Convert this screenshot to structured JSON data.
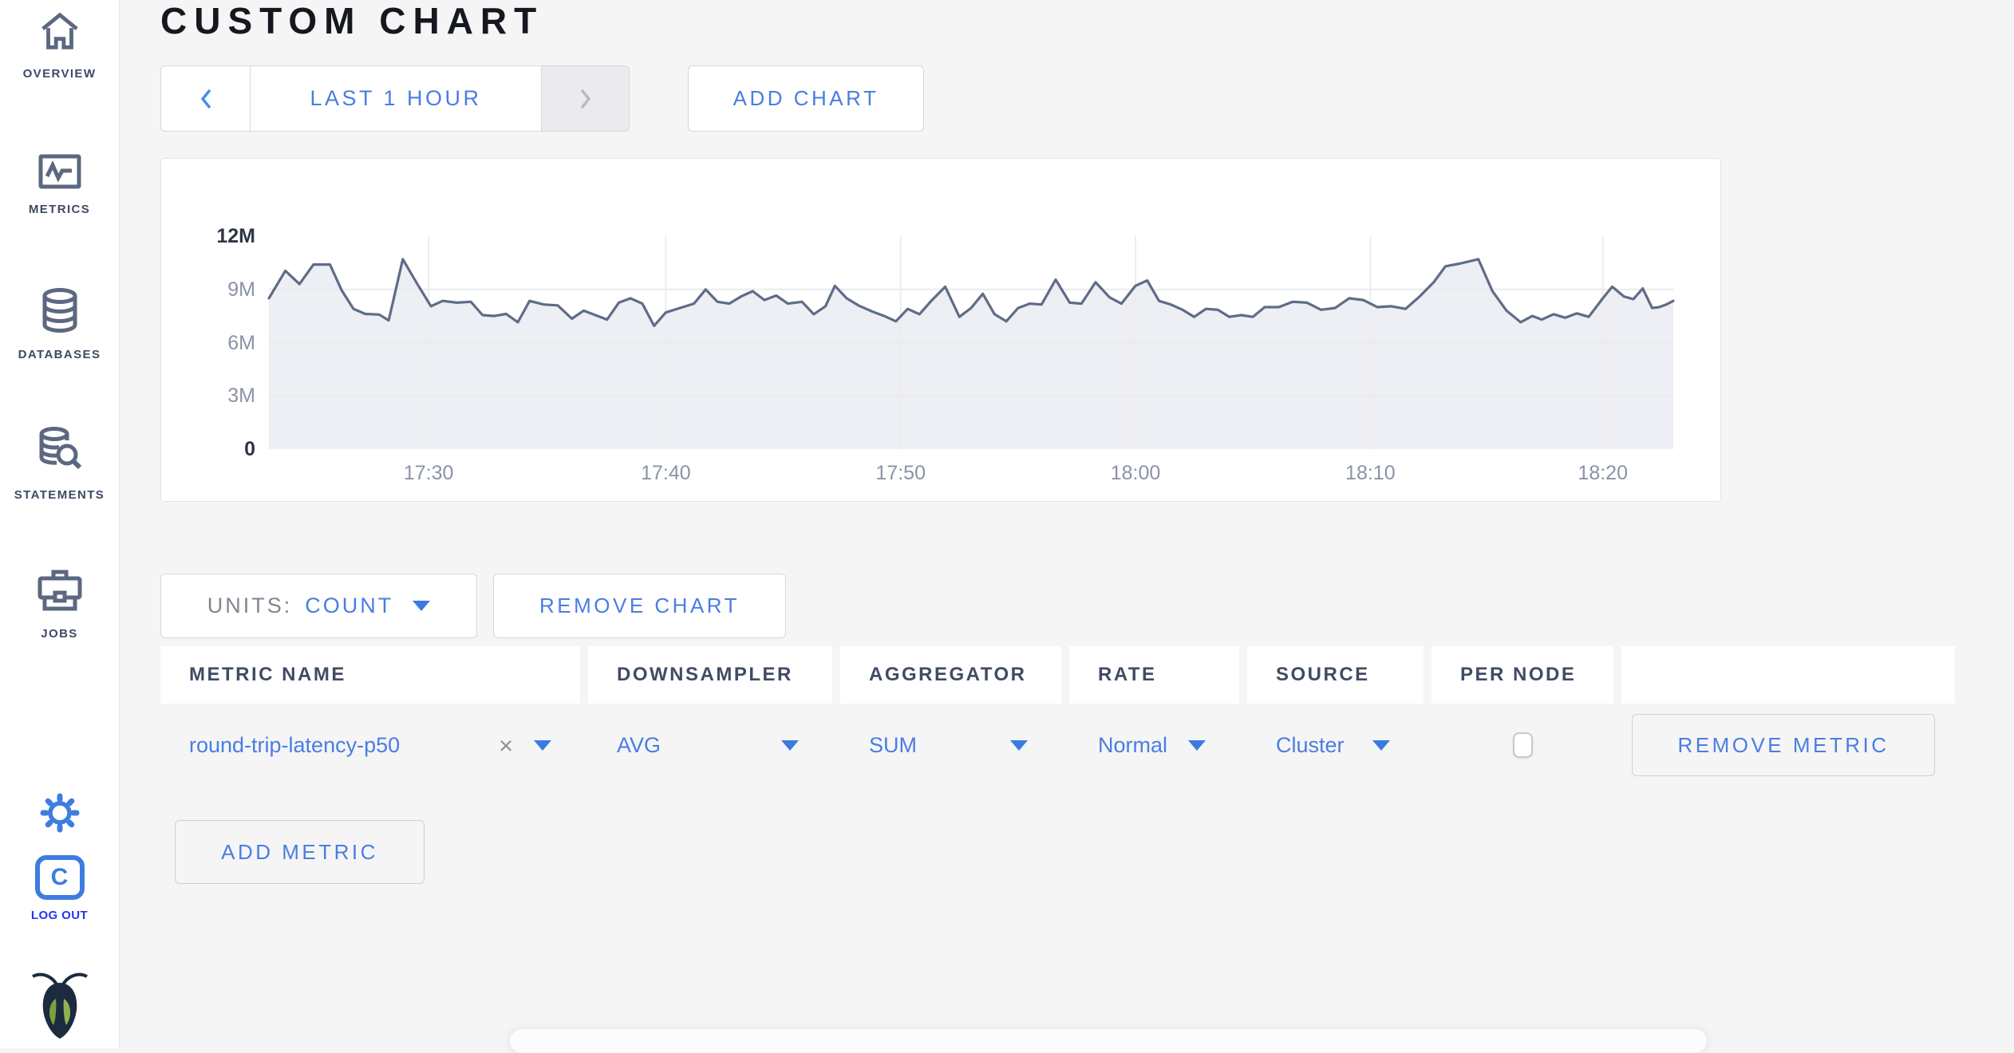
{
  "page": {
    "title": "CUSTOM CHART"
  },
  "colors": {
    "accent_blue": "#4a7de2",
    "logout_blue": "#2334ee",
    "sidebar_icon": "#5b6880",
    "title_text": "#15181f",
    "muted_text": "#7f858f"
  },
  "sidebar": {
    "items": [
      {
        "label": "OVERVIEW",
        "icon": "home-icon"
      },
      {
        "label": "METRICS",
        "icon": "metrics-icon"
      },
      {
        "label": "DATABASES",
        "icon": "database-icon"
      },
      {
        "label": "STATEMENTS",
        "icon": "statements-icon"
      },
      {
        "label": "JOBS",
        "icon": "briefcase-icon"
      }
    ],
    "logo_letter": "C",
    "logout_label": "LOG OUT"
  },
  "toolbar": {
    "time_range": "LAST 1 HOUR",
    "add_chart_label": "ADD CHART"
  },
  "chart_controls": {
    "units_label": "UNITS:",
    "units_value": "COUNT",
    "remove_chart_label": "REMOVE CHART",
    "add_metric_label": "ADD METRIC"
  },
  "metrics_table": {
    "columns": [
      "METRIC NAME",
      "DOWNSAMPLER",
      "AGGREGATOR",
      "RATE",
      "SOURCE",
      "PER NODE"
    ],
    "rows": [
      {
        "metric_name": "round-trip-latency-p50",
        "downsampler": "AVG",
        "aggregator": "SUM",
        "rate": "Normal",
        "source": "Cluster",
        "per_node_checked": false,
        "remove_label": "REMOVE METRIC"
      }
    ]
  },
  "chart_data": {
    "type": "area",
    "title": "",
    "ylabel": "count",
    "ylim_millions": [
      0,
      12
    ],
    "yticks": [
      {
        "value_millions": 12,
        "label": "12M"
      },
      {
        "value_millions": 9,
        "label": "9M"
      },
      {
        "value_millions": 6,
        "label": "6M"
      },
      {
        "value_millions": 3,
        "label": "3M"
      },
      {
        "value_millions": 0,
        "label": "0"
      }
    ],
    "x_range_minutes": [
      0,
      59.8
    ],
    "xticks": [
      {
        "t": 6.8,
        "label": "17:30"
      },
      {
        "t": 16.9,
        "label": "17:40"
      },
      {
        "t": 26.9,
        "label": "17:50"
      },
      {
        "t": 36.9,
        "label": "18:00"
      },
      {
        "t": 46.9,
        "label": "18:10"
      },
      {
        "t": 56.8,
        "label": "18:20"
      }
    ],
    "grid": true,
    "legend": "none",
    "points_min_millions": [
      [
        0,
        8.5
      ],
      [
        0.7,
        10.05
      ],
      [
        1.3,
        9.3
      ],
      [
        1.9,
        10.4
      ],
      [
        2.6,
        10.4
      ],
      [
        3.1,
        8.95
      ],
      [
        3.6,
        7.9
      ],
      [
        4.1,
        7.62
      ],
      [
        4.7,
        7.58
      ],
      [
        5.1,
        7.25
      ],
      [
        5.7,
        10.7
      ],
      [
        6.3,
        9.35
      ],
      [
        6.9,
        8.05
      ],
      [
        7.4,
        8.35
      ],
      [
        8.0,
        8.25
      ],
      [
        8.6,
        8.3
      ],
      [
        9.1,
        7.55
      ],
      [
        9.6,
        7.5
      ],
      [
        10.1,
        7.62
      ],
      [
        10.6,
        7.15
      ],
      [
        11.1,
        8.35
      ],
      [
        11.7,
        8.15
      ],
      [
        12.3,
        8.1
      ],
      [
        12.9,
        7.35
      ],
      [
        13.4,
        7.8
      ],
      [
        13.9,
        7.55
      ],
      [
        14.4,
        7.3
      ],
      [
        14.9,
        8.25
      ],
      [
        15.4,
        8.5
      ],
      [
        15.9,
        8.2
      ],
      [
        16.4,
        6.95
      ],
      [
        16.9,
        7.7
      ],
      [
        17.5,
        7.95
      ],
      [
        18.1,
        8.2
      ],
      [
        18.6,
        9.0
      ],
      [
        19.1,
        8.3
      ],
      [
        19.6,
        8.2
      ],
      [
        20.1,
        8.6
      ],
      [
        20.6,
        8.9
      ],
      [
        21.1,
        8.4
      ],
      [
        21.6,
        8.65
      ],
      [
        22.1,
        8.2
      ],
      [
        22.7,
        8.3
      ],
      [
        23.2,
        7.6
      ],
      [
        23.7,
        8.05
      ],
      [
        24.1,
        9.2
      ],
      [
        24.6,
        8.5
      ],
      [
        25.1,
        8.1
      ],
      [
        25.7,
        7.75
      ],
      [
        26.2,
        7.5
      ],
      [
        26.7,
        7.2
      ],
      [
        27.2,
        7.9
      ],
      [
        27.7,
        7.6
      ],
      [
        28.2,
        8.35
      ],
      [
        28.8,
        9.15
      ],
      [
        29.4,
        7.45
      ],
      [
        29.9,
        7.95
      ],
      [
        30.4,
        8.75
      ],
      [
        30.9,
        7.6
      ],
      [
        31.4,
        7.2
      ],
      [
        31.9,
        7.95
      ],
      [
        32.4,
        8.2
      ],
      [
        32.9,
        8.15
      ],
      [
        33.5,
        9.55
      ],
      [
        34.1,
        8.25
      ],
      [
        34.6,
        8.2
      ],
      [
        35.2,
        9.4
      ],
      [
        35.8,
        8.55
      ],
      [
        36.3,
        8.2
      ],
      [
        36.9,
        9.2
      ],
      [
        37.4,
        9.5
      ],
      [
        37.9,
        8.35
      ],
      [
        38.4,
        8.15
      ],
      [
        38.9,
        7.85
      ],
      [
        39.4,
        7.45
      ],
      [
        39.9,
        7.9
      ],
      [
        40.4,
        7.85
      ],
      [
        40.9,
        7.45
      ],
      [
        41.4,
        7.55
      ],
      [
        41.9,
        7.45
      ],
      [
        42.4,
        8.0
      ],
      [
        43.0,
        8.0
      ],
      [
        43.6,
        8.3
      ],
      [
        44.2,
        8.25
      ],
      [
        44.8,
        7.85
      ],
      [
        45.4,
        7.95
      ],
      [
        46.0,
        8.5
      ],
      [
        46.6,
        8.4
      ],
      [
        47.2,
        8.0
      ],
      [
        47.8,
        8.05
      ],
      [
        48.4,
        7.9
      ],
      [
        49.0,
        8.6
      ],
      [
        49.6,
        9.4
      ],
      [
        50.1,
        10.3
      ],
      [
        50.7,
        10.45
      ],
      [
        51.5,
        10.7
      ],
      [
        52.1,
        8.9
      ],
      [
        52.7,
        7.8
      ],
      [
        53.3,
        7.15
      ],
      [
        53.8,
        7.5
      ],
      [
        54.2,
        7.3
      ],
      [
        54.7,
        7.6
      ],
      [
        55.2,
        7.4
      ],
      [
        55.7,
        7.65
      ],
      [
        56.2,
        7.45
      ],
      [
        56.8,
        8.5
      ],
      [
        57.2,
        9.15
      ],
      [
        57.7,
        8.6
      ],
      [
        58.1,
        8.45
      ],
      [
        58.5,
        9.05
      ],
      [
        58.9,
        7.95
      ],
      [
        59.2,
        8.0
      ],
      [
        59.5,
        8.15
      ],
      [
        59.8,
        8.35
      ]
    ],
    "colors": {
      "line": "#5f6c87",
      "fill": "#edeff4",
      "hgrid": "#e9eaec",
      "vgrid": "#ededf0",
      "tick_label": "#8a93a6",
      "tick_label_strong": "#2e3646"
    }
  }
}
